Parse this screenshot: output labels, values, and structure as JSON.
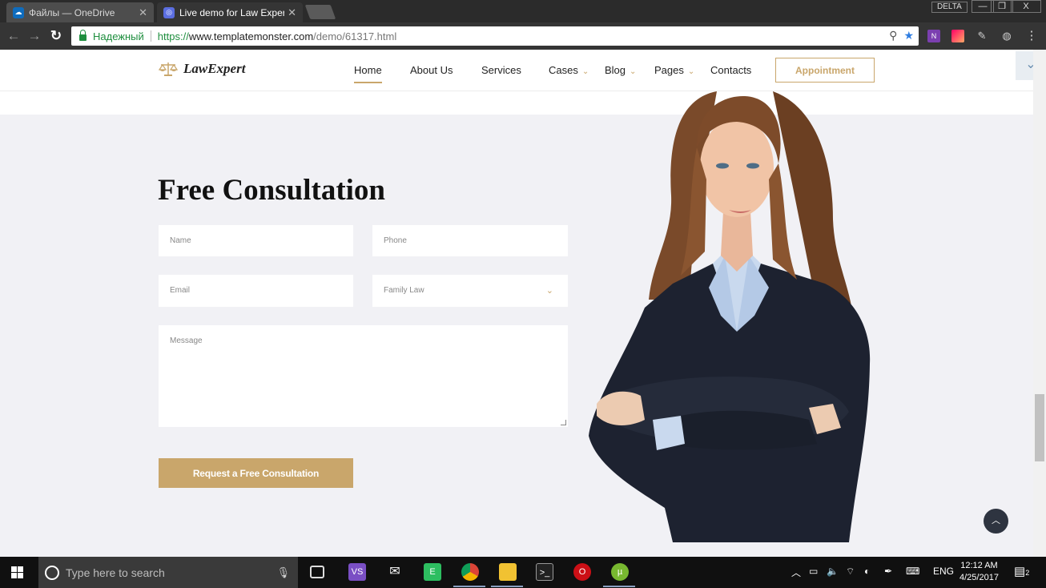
{
  "browser": {
    "tabs": [
      {
        "title": "Файлы — OneDrive",
        "active": false,
        "icon": "onedrive-icon"
      },
      {
        "title": "Live demo for Law Expert",
        "active": true,
        "icon": "templatemonster-icon"
      }
    ],
    "profile_label": "DELTA",
    "window_controls": {
      "minimize": "—",
      "restore": "❐",
      "close": "X"
    },
    "secure_label": "Надежный",
    "url": {
      "scheme": "https://",
      "host": "www.templatemonster.com",
      "path": "/demo/61317.html"
    },
    "extensions": [
      "onenote-icon",
      "color-icon",
      "pen-icon",
      "evernote-icon"
    ],
    "menu_icon": "⋮"
  },
  "site": {
    "logo_text": "LawExpert",
    "nav": [
      {
        "label": "Home",
        "has_dropdown": false,
        "current": true
      },
      {
        "label": "About Us",
        "has_dropdown": false,
        "current": false
      },
      {
        "label": "Services",
        "has_dropdown": false,
        "current": false
      },
      {
        "label": "Cases",
        "has_dropdown": true,
        "current": false
      },
      {
        "label": "Blog",
        "has_dropdown": true,
        "current": false
      },
      {
        "label": "Pages",
        "has_dropdown": true,
        "current": false
      },
      {
        "label": "Contacts",
        "has_dropdown": false,
        "current": false
      }
    ],
    "appointment_label": "Appointment",
    "accent_color": "#c9a66b"
  },
  "consultation": {
    "title": "Free Consultation",
    "name_placeholder": "Name",
    "phone_placeholder": "Phone",
    "email_placeholder": "Email",
    "practice_selected": "Family Law",
    "message_placeholder": "Message",
    "submit_label": "Request a Free Consultation"
  },
  "taskbar": {
    "search_placeholder": "Type here to search",
    "apps": [
      "visual-studio-icon",
      "mail-icon",
      "evernote-icon",
      "chrome-icon",
      "file-explorer-icon",
      "terminal-icon",
      "opera-icon",
      "utorrent-icon"
    ],
    "language": "ENG",
    "time": "12:12 AM",
    "date": "4/25/2017",
    "notifications": "2"
  }
}
